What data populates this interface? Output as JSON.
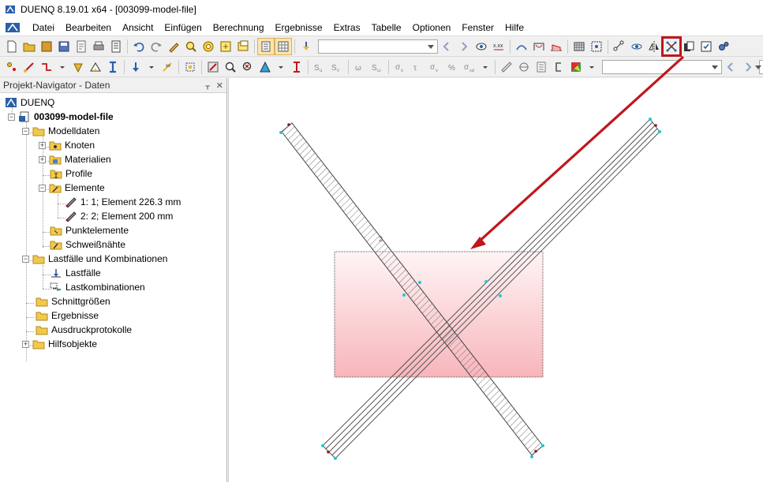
{
  "window": {
    "title": "DUENQ 8.19.01 x64 - [003099-model-file]"
  },
  "menu": {
    "items": [
      "Datei",
      "Bearbeiten",
      "Ansicht",
      "Einfügen",
      "Berechnung",
      "Ergebnisse",
      "Extras",
      "Tabelle",
      "Optionen",
      "Fenster",
      "Hilfe"
    ]
  },
  "navigator": {
    "title": "Projekt-Navigator - Daten",
    "pin_label": "ᚁ",
    "close_label": "✕",
    "tree": {
      "root": "DUENQ",
      "model": "003099-model-file",
      "modelldaten": "Modelldaten",
      "knoten": "Knoten",
      "materialien": "Materialien",
      "profile": "Profile",
      "elemente": "Elemente",
      "element1": "1: 1; Element 226.3 mm",
      "element2": "2: 2; Element 200 mm",
      "punktelemente": "Punktelemente",
      "schweissnaehte": "Schweißnähte",
      "lastfaelle_kombinationen": "Lastfälle und Kombinationen",
      "lastfaelle": "Lastfälle",
      "lastkombinationen": "Lastkombinationen",
      "schnittgroessen": "Schnittgrößen",
      "ergebnisse": "Ergebnisse",
      "ausdruckprotokolle": "Ausdruckprotokolle",
      "hilfsobjekte": "Hilfsobjekte"
    }
  },
  "workspace": {
    "element_label": "2"
  },
  "colors": {
    "accent_red": "#c0161c",
    "selection_fill": "#f8c8cc",
    "node_cyan": "#21c8d8"
  }
}
